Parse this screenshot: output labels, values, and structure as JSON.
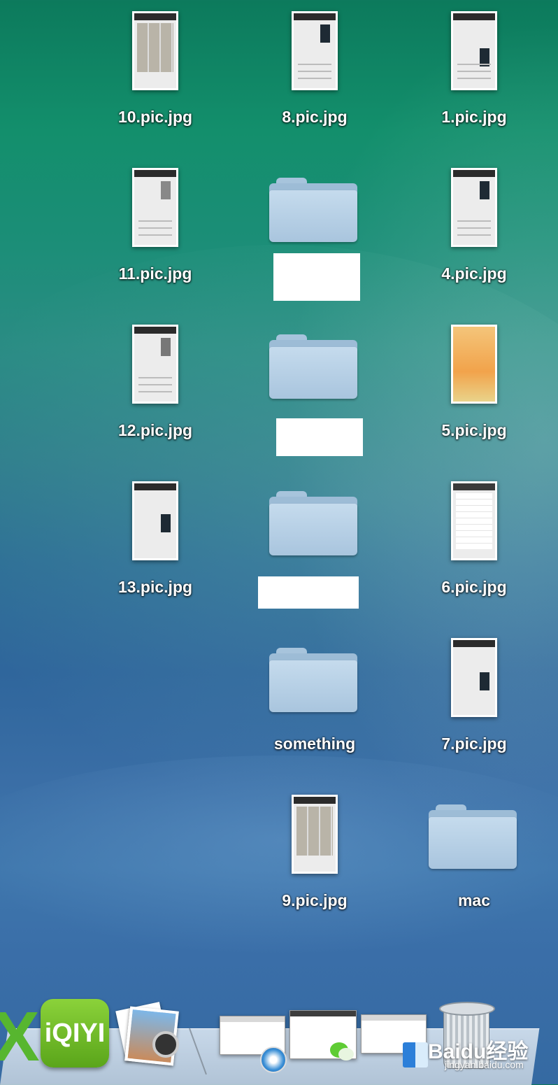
{
  "desktop": {
    "items": [
      {
        "label": "10.pic.jpg",
        "kind": "image"
      },
      {
        "label": "8.pic.jpg",
        "kind": "image"
      },
      {
        "label": "1.pic.jpg",
        "kind": "image"
      },
      {
        "label": "11.pic.jpg",
        "kind": "image"
      },
      {
        "label": "",
        "kind": "folder"
      },
      {
        "label": "4.pic.jpg",
        "kind": "image"
      },
      {
        "label": "12.pic.jpg",
        "kind": "image"
      },
      {
        "label": "",
        "kind": "folder"
      },
      {
        "label": "5.pic.jpg",
        "kind": "image"
      },
      {
        "label": "13.pic.jpg",
        "kind": "image"
      },
      {
        "label": "",
        "kind": "folder"
      },
      {
        "label": "6.pic.jpg",
        "kind": "image"
      },
      {
        "label": "something",
        "kind": "folder"
      },
      {
        "label": "7.pic.jpg",
        "kind": "image"
      },
      {
        "label": "9.pic.jpg",
        "kind": "image"
      },
      {
        "label": "mac",
        "kind": "folder"
      }
    ]
  },
  "dock": {
    "excel_glyph": "X",
    "iqiyi_label": "iQIYI",
    "icons": [
      "excel-icon",
      "iqiyi-icon",
      "preview-icon",
      "safari-icon",
      "wechat-icon",
      "finder-icon",
      "trash-icon"
    ]
  },
  "watermark": {
    "brand": "Baidu经验",
    "url": "jingyan.baidu.com"
  }
}
